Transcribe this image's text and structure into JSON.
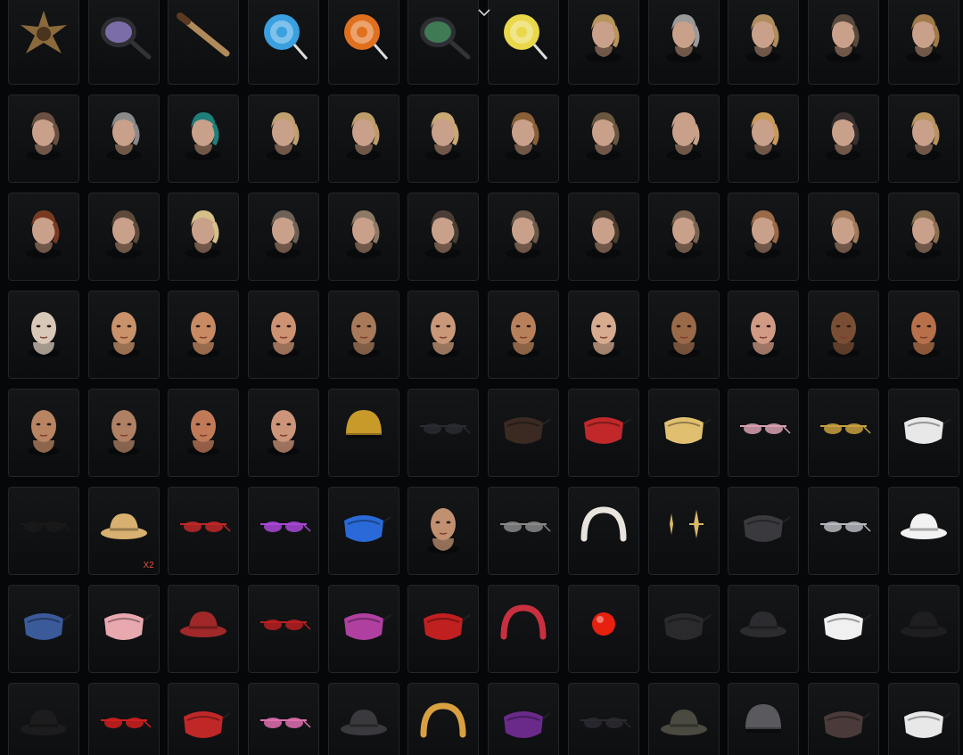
{
  "inventory": {
    "items": [
      {
        "icon": "spiked-emblem-icon",
        "kind": "emblem",
        "color": "#8a6a3a"
      },
      {
        "icon": "frying-pan-icon",
        "kind": "pan",
        "color": "#7b6ea8"
      },
      {
        "icon": "baseball-bat-icon",
        "kind": "bat",
        "color": "#b08a5a"
      },
      {
        "icon": "lollipop-blue-icon",
        "kind": "candy",
        "color": "#3aa0e0"
      },
      {
        "icon": "lollipop-orange-icon",
        "kind": "candy",
        "color": "#e0701e"
      },
      {
        "icon": "green-pan-icon",
        "kind": "pan",
        "color": "#3f7a55"
      },
      {
        "icon": "lollipop-swirl-icon",
        "kind": "candy",
        "color": "#e8d84a"
      },
      {
        "icon": "long-blonde-hair-icon",
        "kind": "hair",
        "color": "#b8955a"
      },
      {
        "icon": "short-gray-hair-icon",
        "kind": "hair",
        "color": "#9a9a9a"
      },
      {
        "icon": "braided-blonde-hair-icon",
        "kind": "hair",
        "color": "#b08d5c"
      },
      {
        "icon": "undercut-hair-icon",
        "kind": "hair",
        "color": "#5a4a3e"
      },
      {
        "icon": "wavy-blonde-hair-icon",
        "kind": "hair",
        "color": "#a07a48"
      },
      {
        "icon": "messy-short-hair-icon",
        "kind": "hair",
        "color": "#6a5040"
      },
      {
        "icon": "bald-head-icon",
        "kind": "hair",
        "color": "#8a8a8a"
      },
      {
        "icon": "teal-bob-hair-icon",
        "kind": "hair",
        "color": "#1f7f7a"
      },
      {
        "icon": "blonde-bob-hair-icon",
        "kind": "hair",
        "color": "#c0a070"
      },
      {
        "icon": "blonde-bun-hair-icon",
        "kind": "hair",
        "color": "#bd9c6a"
      },
      {
        "icon": "blonde-ponytail-hair-icon",
        "kind": "hair",
        "color": "#c9a873"
      },
      {
        "icon": "leopard-buzz-hair-icon",
        "kind": "hair",
        "color": "#8a6038"
      },
      {
        "icon": "brown-curly-hair-icon",
        "kind": "hair",
        "color": "#6b5640"
      },
      {
        "icon": "pink-blonde-hair-icon",
        "kind": "hair",
        "color": "#c8a088"
      },
      {
        "icon": "golden-bob-hair-icon",
        "kind": "hair",
        "color": "#c89a5a"
      },
      {
        "icon": "dark-bun-hair-icon",
        "kind": "hair",
        "color": "#3a3030"
      },
      {
        "icon": "blonde-braid-hair-icon",
        "kind": "hair",
        "color": "#b8935e"
      },
      {
        "icon": "red-braids-hair-icon",
        "kind": "hair",
        "color": "#7a3a22"
      },
      {
        "icon": "curly-topknot-hair-icon",
        "kind": "hair",
        "color": "#5e4a3a"
      },
      {
        "icon": "platinum-bun-hair-icon",
        "kind": "hair",
        "color": "#d6c08a"
      },
      {
        "icon": "short-bowl-hair-icon",
        "kind": "hair",
        "color": "#6e6258"
      },
      {
        "icon": "ash-bob-hair-icon",
        "kind": "hair",
        "color": "#8c7a66"
      },
      {
        "icon": "crew-cut-hair-icon",
        "kind": "hair",
        "color": "#4a3e36"
      },
      {
        "icon": "side-part-hair-icon",
        "kind": "hair",
        "color": "#6e5a4a"
      },
      {
        "icon": "dreadlock-bun-hair-icon",
        "kind": "hair",
        "color": "#4e3e30"
      },
      {
        "icon": "swept-hair-icon",
        "kind": "hair",
        "color": "#7a6250"
      },
      {
        "icon": "auburn-bob-hair-icon",
        "kind": "hair",
        "color": "#9a6a48"
      },
      {
        "icon": "layered-bob-hair-icon",
        "kind": "hair",
        "color": "#a07a5a"
      },
      {
        "icon": "fringe-hair-icon",
        "kind": "hair",
        "color": "#8a7050"
      },
      {
        "icon": "pale-painted-face-icon",
        "kind": "face",
        "color": "#d8c8b8"
      },
      {
        "icon": "tattooed-face-icon",
        "kind": "face",
        "color": "#c9926a"
      },
      {
        "icon": "freckled-face-icon",
        "kind": "face",
        "color": "#c88a62"
      },
      {
        "icon": "makeup-face-icon",
        "kind": "face",
        "color": "#cc9272"
      },
      {
        "icon": "bearded-face-icon",
        "kind": "face",
        "color": "#a87a5a"
      },
      {
        "icon": "bald-face-icon",
        "kind": "face",
        "color": "#c89878"
      },
      {
        "icon": "tan-face-icon",
        "kind": "face",
        "color": "#b8805a"
      },
      {
        "icon": "light-face-icon",
        "kind": "face",
        "color": "#d6ab8e"
      },
      {
        "icon": "brown-face-icon",
        "kind": "face",
        "color": "#9a6a48"
      },
      {
        "icon": "rosy-face-icon",
        "kind": "face",
        "color": "#d09a84"
      },
      {
        "icon": "dark-face-icon",
        "kind": "face",
        "color": "#7a4e34"
      },
      {
        "icon": "auburn-face-icon",
        "kind": "face",
        "color": "#b8704a"
      },
      {
        "icon": "warm-face-icon",
        "kind": "face",
        "color": "#b88462"
      },
      {
        "icon": "stubble-face-icon",
        "kind": "face",
        "color": "#b08064"
      },
      {
        "icon": "ginger-face-icon",
        "kind": "face",
        "color": "#c07a58"
      },
      {
        "icon": "painted-eyes-face-icon",
        "kind": "face",
        "color": "#cc9478"
      },
      {
        "icon": "golden-helmet-icon",
        "kind": "helmet",
        "color": "#c89a2a"
      },
      {
        "icon": "black-visor-icon",
        "kind": "visor",
        "color": "#2a2c30"
      },
      {
        "icon": "chain-mask-icon",
        "kind": "mask",
        "color": "#3a2a22"
      },
      {
        "icon": "grin-mask-icon",
        "kind": "mask",
        "color": "#c0282a"
      },
      {
        "icon": "fox-mask-icon",
        "kind": "mask",
        "color": "#e0c070"
      },
      {
        "icon": "heart-glasses-icon",
        "kind": "glasses",
        "color": "#d8a0b0"
      },
      {
        "icon": "gold-rim-glasses-icon",
        "kind": "glasses",
        "color": "#c8a040"
      },
      {
        "icon": "zebra-mask-icon",
        "kind": "mask",
        "color": "#e8e8e8"
      },
      {
        "icon": "black-sunglasses-icon",
        "kind": "glasses",
        "color": "#1a1a1a"
      },
      {
        "icon": "straw-hat-icon",
        "kind": "hat",
        "color": "#d8b070",
        "badge": "X2"
      },
      {
        "icon": "red-round-glasses-icon",
        "kind": "glasses",
        "color": "#c02828"
      },
      {
        "icon": "purple-heart-glasses-icon",
        "kind": "glasses",
        "color": "#a848d8"
      },
      {
        "icon": "blue-face-mask-icon",
        "kind": "mask",
        "color": "#2a6ad8"
      },
      {
        "icon": "mannequin-head-icon",
        "kind": "face",
        "color": "#c09070"
      },
      {
        "icon": "aviator-glasses-icon",
        "kind": "glasses",
        "color": "#8a8a8a"
      },
      {
        "icon": "fur-headband-icon",
        "kind": "headband",
        "color": "#e8e4dc"
      },
      {
        "icon": "star-earrings-icon",
        "kind": "earring",
        "color": "#d8b868"
      },
      {
        "icon": "studded-mask-icon",
        "kind": "mask",
        "color": "#3a3a3e"
      },
      {
        "icon": "shutter-glasses-icon",
        "kind": "glasses",
        "color": "#b8b8c0"
      },
      {
        "icon": "captain-hat-icon",
        "kind": "hat",
        "color": "#f2f2f2"
      },
      {
        "icon": "oni-mask-icon",
        "kind": "mask",
        "color": "#3a5a9a"
      },
      {
        "icon": "pink-sleep-mask-icon",
        "kind": "mask",
        "color": "#e8a8b0"
      },
      {
        "icon": "studded-beret-icon",
        "kind": "hat",
        "color": "#a02828"
      },
      {
        "icon": "red-chain-glasses-icon",
        "kind": "glasses",
        "color": "#b82020"
      },
      {
        "icon": "purple-eyepatch-icon",
        "kind": "mask",
        "color": "#b040a0"
      },
      {
        "icon": "red-tech-mask-icon",
        "kind": "mask",
        "color": "#c02020"
      },
      {
        "icon": "bunny-ears-icon",
        "kind": "headband",
        "color": "#c83040"
      },
      {
        "icon": "red-nose-icon",
        "kind": "nose",
        "color": "#e82010"
      },
      {
        "icon": "black-cloth-mask-icon",
        "kind": "mask",
        "color": "#2a2a2c"
      },
      {
        "icon": "black-cap-icon",
        "kind": "hat",
        "color": "#2c2c30"
      },
      {
        "icon": "white-face-mask-icon",
        "kind": "mask",
        "color": "#f0f0f0"
      },
      {
        "icon": "fedora-hat-icon",
        "kind": "hat",
        "color": "#1e1e20"
      },
      {
        "icon": "black-hat-icon",
        "kind": "hat",
        "color": "#1c1c1e"
      },
      {
        "icon": "red-heart-glasses-icon",
        "kind": "glasses",
        "color": "#d02020"
      },
      {
        "icon": "bandana-mask-icon",
        "kind": "mask",
        "color": "#c02828"
      },
      {
        "icon": "pink-visor-glasses-icon",
        "kind": "glasses",
        "color": "#e070b0"
      },
      {
        "icon": "headphone-cap-icon",
        "kind": "hat",
        "color": "#3a3a3e"
      },
      {
        "icon": "reindeer-antlers-icon",
        "kind": "headband",
        "color": "#d8a040"
      },
      {
        "icon": "purple-mask-icon",
        "kind": "mask",
        "color": "#6a2a8a"
      },
      {
        "icon": "goggles-icon",
        "kind": "glasses",
        "color": "#2a2a30"
      },
      {
        "icon": "camo-cap-icon",
        "kind": "hat",
        "color": "#4a4a40"
      },
      {
        "icon": "headset-helmet-icon",
        "kind": "helmet",
        "color": "#5a5a5e"
      },
      {
        "icon": "leather-mask-icon",
        "kind": "mask",
        "color": "#4a3a3a"
      },
      {
        "icon": "white-respirator-icon",
        "kind": "mask",
        "color": "#e8e8e8"
      }
    ]
  },
  "header": {
    "collapse_icon": "chevron-down-icon"
  }
}
